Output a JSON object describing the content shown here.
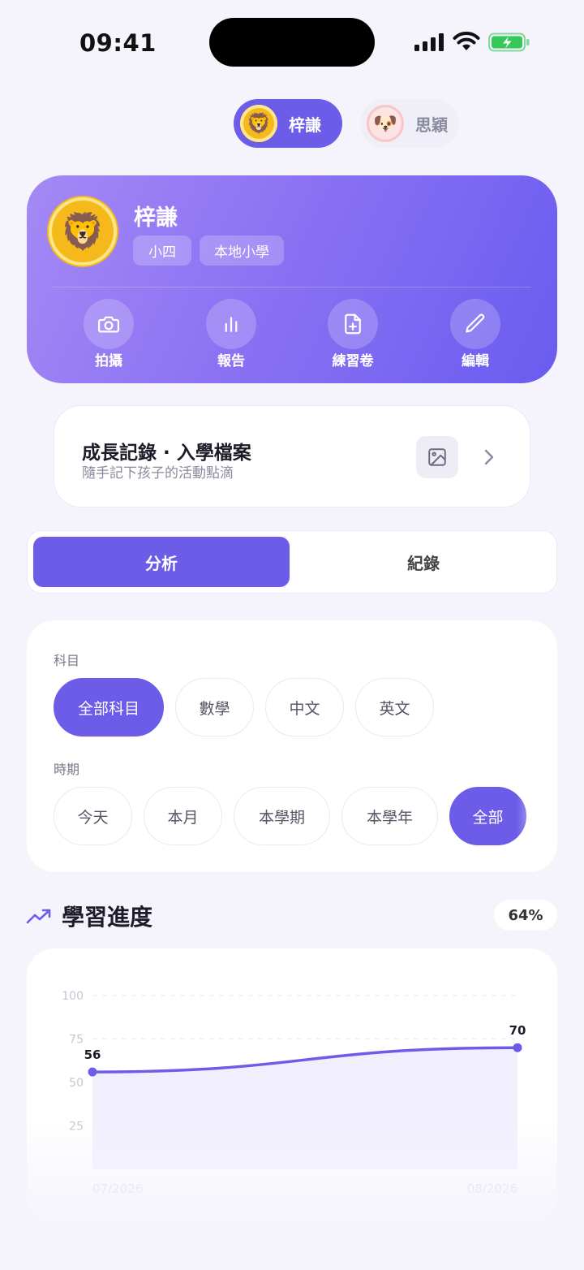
{
  "status_bar": {
    "time": "09:41"
  },
  "children": [
    {
      "name": "梓謙",
      "avatar": "🦁",
      "active": true
    },
    {
      "name": "思穎",
      "avatar": "🐶",
      "active": false
    }
  ],
  "profile": {
    "name": "梓謙",
    "avatar": "🦁",
    "grade": "小四",
    "school_type": "本地小學",
    "actions": [
      {
        "label": "拍攝",
        "icon": "camera-icon"
      },
      {
        "label": "報告",
        "icon": "bar-chart-icon"
      },
      {
        "label": "練習卷",
        "icon": "file-plus-icon"
      },
      {
        "label": "編輯",
        "icon": "pencil-icon"
      }
    ]
  },
  "growth_card": {
    "title": "成長記錄 · 入學檔案",
    "subtitle": "隨手記下孩子的活動點滴",
    "icons": [
      "image-icon",
      "chevron-right-icon"
    ]
  },
  "tabs": [
    {
      "label": "分析",
      "active": true
    },
    {
      "label": "紀錄",
      "active": false
    }
  ],
  "filters": {
    "subject_label": "科目",
    "subjects": [
      {
        "label": "全部科目",
        "selected": true
      },
      {
        "label": "數學",
        "selected": false
      },
      {
        "label": "中文",
        "selected": false
      },
      {
        "label": "英文",
        "selected": false
      }
    ],
    "period_label": "時期",
    "periods": [
      {
        "label": "今天",
        "selected": false
      },
      {
        "label": "本月",
        "selected": false
      },
      {
        "label": "本學期",
        "selected": false
      },
      {
        "label": "本學年",
        "selected": false
      },
      {
        "label": "全部",
        "selected": true
      }
    ]
  },
  "progress": {
    "title": "學習進度",
    "percent": "64%",
    "icon": "trending-up-icon"
  },
  "chart_data": {
    "type": "area",
    "title": "",
    "xlabel": "",
    "ylabel": "",
    "x": [
      "07/2026",
      "08/2026"
    ],
    "series": [
      {
        "values": [
          56,
          70
        ]
      }
    ],
    "ylim": [
      0,
      100
    ],
    "yticks": [
      25,
      50,
      75,
      100
    ],
    "grid": true,
    "color": "#6c5ce7"
  },
  "colors": {
    "accent": "#6c5ce7",
    "background": "#f5f4fc"
  }
}
